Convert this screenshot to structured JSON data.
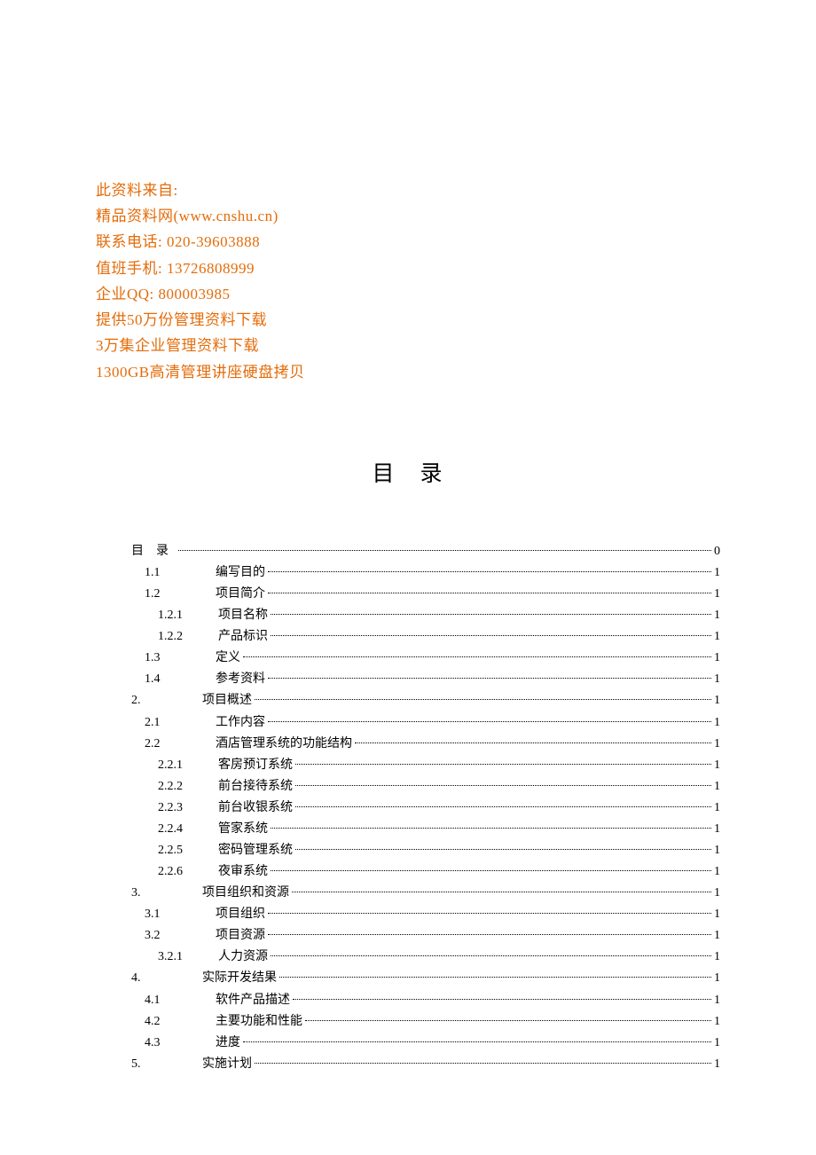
{
  "header": {
    "lines": [
      "此资料来自:",
      "精品资料网(www.cnshu.cn)",
      "联系电话: 020-39603888",
      "值班手机: 13726808999",
      "企业QQ: 800003985",
      "提供50万份管理资料下载",
      "3万集企业管理资料下载",
      "1300GB高清管理讲座硬盘拷贝"
    ]
  },
  "toc_title": "目　录",
  "toc": [
    {
      "level": 1,
      "num": "目　录",
      "label": "",
      "page": "0",
      "gap": "large"
    },
    {
      "level": 2,
      "num": "1.1",
      "label": "编写目的",
      "page": "1",
      "gap": "med"
    },
    {
      "level": 2,
      "num": "1.2",
      "label": "项目简介",
      "page": "1",
      "gap": "med"
    },
    {
      "level": 3,
      "num": "1.2.1",
      "label": "项目名称",
      "page": "1",
      "gap": "small"
    },
    {
      "level": 3,
      "num": "1.2.2",
      "label": "产品标识",
      "page": "1",
      "gap": "small"
    },
    {
      "level": 2,
      "num": "1.3",
      "label": "定义",
      "page": "1",
      "gap": "med"
    },
    {
      "level": 2,
      "num": "1.4",
      "label": "参考资料",
      "page": "1",
      "gap": "med"
    },
    {
      "level": 1,
      "num": "2.",
      "label": "项目概述",
      "page": "1",
      "gap": "med"
    },
    {
      "level": 2,
      "num": "2.1",
      "label": "工作内容",
      "page": "1",
      "gap": "med"
    },
    {
      "level": 2,
      "num": "2.2",
      "label": "酒店管理系统的功能结构",
      "page": "1",
      "gap": "med"
    },
    {
      "level": 3,
      "num": "2.2.1",
      "label": "客房预订系统",
      "page": "1",
      "gap": "small"
    },
    {
      "level": 3,
      "num": "2.2.2",
      "label": "前台接待系统",
      "page": "1",
      "gap": "small"
    },
    {
      "level": 3,
      "num": "2.2.3",
      "label": "前台收银系统",
      "page": "1",
      "gap": "small"
    },
    {
      "level": 3,
      "num": "2.2.4",
      "label": "管家系统",
      "page": "1",
      "gap": "small"
    },
    {
      "level": 3,
      "num": "2.2.5",
      "label": "密码管理系统",
      "page": "1",
      "gap": "small"
    },
    {
      "level": 3,
      "num": "2.2.6",
      "label": "夜审系统",
      "page": "1",
      "gap": "small"
    },
    {
      "level": 1,
      "num": "3.",
      "label": "项目组织和资源",
      "page": "1",
      "gap": "med"
    },
    {
      "level": 2,
      "num": "3.1",
      "label": "项目组织",
      "page": "1",
      "gap": "med"
    },
    {
      "level": 2,
      "num": "3.2",
      "label": "项目资源",
      "page": "1",
      "gap": "med"
    },
    {
      "level": 3,
      "num": "3.2.1",
      "label": "人力资源",
      "page": "1",
      "gap": "small"
    },
    {
      "level": 1,
      "num": "4.",
      "label": "实际开发结果",
      "page": "1",
      "gap": "med"
    },
    {
      "level": 2,
      "num": "4.1",
      "label": "软件产品描述",
      "page": "1",
      "gap": "med"
    },
    {
      "level": 2,
      "num": "4.2",
      "label": "主要功能和性能",
      "page": "1",
      "gap": "med"
    },
    {
      "level": 2,
      "num": "4.3",
      "label": "进度",
      "page": "1",
      "gap": "med"
    },
    {
      "level": 1,
      "num": "5.",
      "label": "实施计划",
      "page": "1",
      "gap": "med"
    }
  ]
}
